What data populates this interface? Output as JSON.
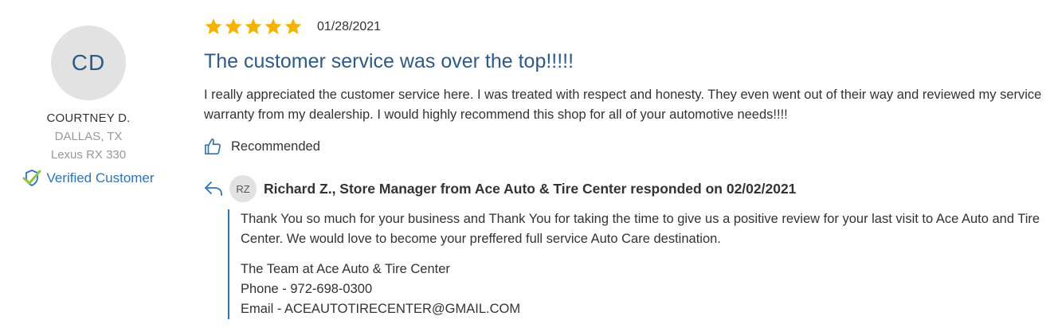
{
  "reviewer": {
    "initials": "CD",
    "name": "COURTNEY D.",
    "location": "DALLAS, TX",
    "vehicle": "Lexus RX 330",
    "verified_label": "Verified Customer"
  },
  "review": {
    "rating": 5,
    "rating_max": 5,
    "date": "01/28/2021",
    "title": "The customer service was over the top!!!!!",
    "body": "I really appreciated the customer service here. I was treated with respect and honesty. They even went out of their way and reviewed my service warranty from my dealership. I would highly recommend this shop for all of your automotive needs!!!!",
    "recommend_label": "Recommended"
  },
  "response": {
    "initials": "RZ",
    "header": "Richard Z., Store Manager from Ace Auto & Tire Center responded on 02/02/2021",
    "body": "Thank You so much for your business and Thank You for taking the time to give us a positive review for your last visit to Ace Auto and Tire Center. We would love to become your preffered full service Auto Care destination.",
    "signature": {
      "team": "The Team at Ace Auto & Tire Center",
      "phone": "Phone - 972-698-0300",
      "email": "Email - ACEAUTOTIRECENTER@GMAIL.COM"
    }
  },
  "colors": {
    "star": "#f5b301",
    "accent_blue": "#2e75b6",
    "title_blue": "#2d5a8a",
    "verified_check": "#8cc63f"
  },
  "icons": {
    "star": "star-icon",
    "verified": "verified-badge-icon",
    "recommend": "thumbs-up-icon",
    "reply": "reply-arrow-icon"
  }
}
